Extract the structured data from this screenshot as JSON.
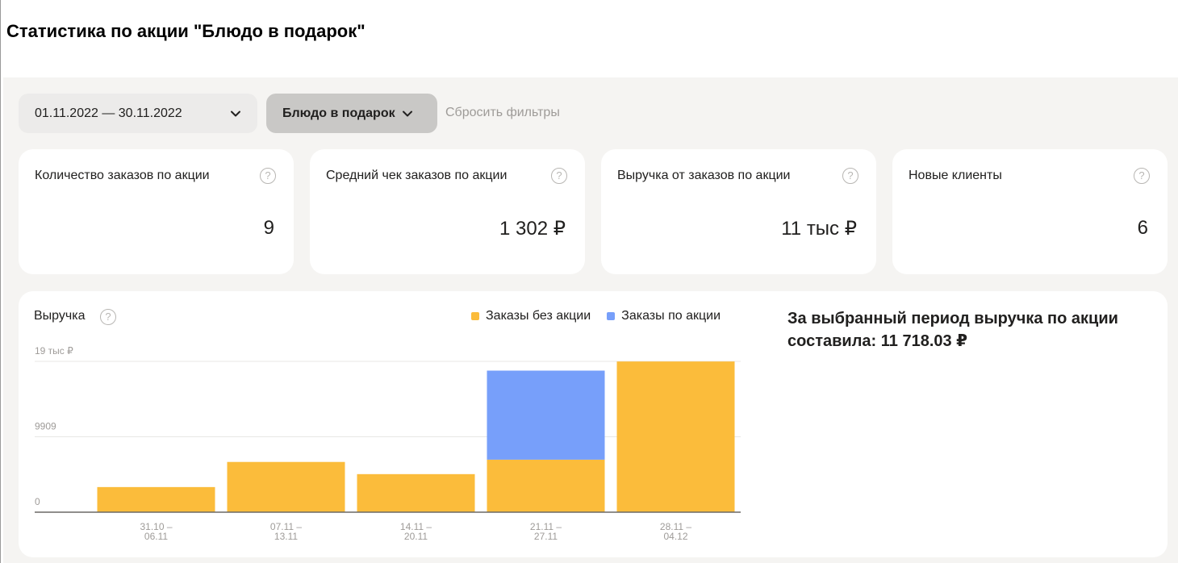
{
  "page": {
    "title": "Статистика по акции \"Блюдо в подарок\""
  },
  "filters": {
    "date_range": "01.11.2022 — 30.11.2022",
    "promo": "Блюдо в подарок",
    "reset": "Сбросить фильтры"
  },
  "help_glyph": "?",
  "cards": [
    {
      "label": "Количество заказов по акции",
      "value": "9"
    },
    {
      "label": "Средний чек заказов по акции",
      "value": "1 302 ₽"
    },
    {
      "label": "Выручка от заказов по акции",
      "value": "11 тыс ₽"
    },
    {
      "label": "Новые клиенты",
      "value": "6"
    }
  ],
  "revenue_chart": {
    "title": "Выручка",
    "summary": "За выбранный период выручка по акции составила: 11 718.03 ₽"
  },
  "icons": {
    "help": "question-circle-icon",
    "dropdown": "chevron-down-icon"
  },
  "colors": {
    "no_promo": "#fbbc3b",
    "promo": "#779ffa",
    "panel": "#f5f4f2"
  },
  "chart_data": {
    "type": "bar",
    "stacked": true,
    "categories": [
      "31.10 – 06.11",
      "07.11 – 13.11",
      "14.11 – 20.11",
      "21.11 – 27.11",
      "28.11 – 04.12"
    ],
    "series": [
      {
        "name": "Заказы без акции",
        "values": [
          3300,
          6600,
          5000,
          6900,
          19800
        ]
      },
      {
        "name": "Заказы по акции",
        "values": [
          0,
          0,
          0,
          11700,
          0
        ]
      }
    ],
    "y_ticks": [
      {
        "value": 0,
        "label": "0"
      },
      {
        "value": 9909,
        "label": "9909"
      },
      {
        "value": 19818,
        "label": "19 тыс ₽"
      }
    ],
    "ylim": [
      0,
      19818
    ],
    "legend_position": "top-right",
    "grid": true
  }
}
